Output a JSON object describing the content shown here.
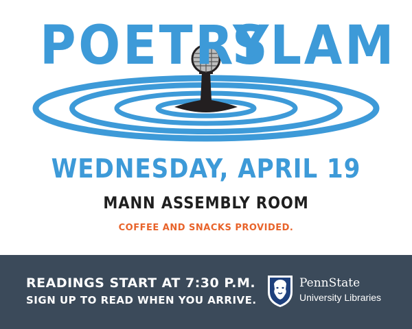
{
  "title": {
    "left": "POETRY",
    "right": "SLAM"
  },
  "event": {
    "date": "WEDNESDAY, APRIL 19",
    "location": "MANN ASSEMBLY ROOM",
    "note": "COFFEE AND SNACKS PROVIDED."
  },
  "footer": {
    "line1": "READINGS START AT 7:30 P.M.",
    "line2": "SIGN UP TO READ WHEN YOU ARRIVE."
  },
  "logo": {
    "name": "PennState",
    "subtitle": "University Libraries"
  },
  "icons": {
    "microphone": "microphone-icon",
    "ripples": "ripple-rings",
    "shield": "nittany-lion-shield-icon"
  },
  "colors": {
    "accent_blue": "#3d9ad8",
    "dark_text": "#1f1f1f",
    "orange": "#e8632a",
    "footer_bg": "#3b4a5a",
    "shield_blue": "#1e407c"
  }
}
